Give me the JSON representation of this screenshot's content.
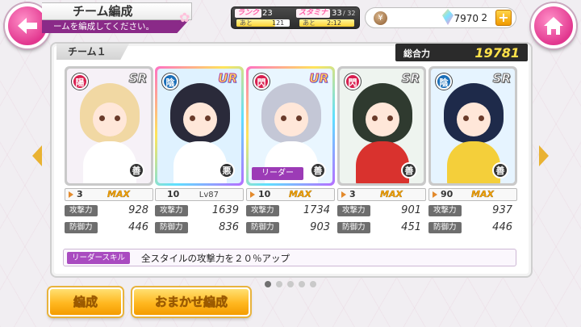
{
  "header": {
    "title": "チーム編成",
    "subtitle": "ームを編成してください。"
  },
  "status": {
    "rank_label": "ランク",
    "rank_value": "23",
    "rank_next_label": "あと",
    "rank_next_value": "121",
    "stamina_label": "スタミナ",
    "stamina_value": "33",
    "stamina_max": "/ 32",
    "stamina_next_label": "あと",
    "stamina_next_value": "2:12",
    "rank_progress": 0.72,
    "stamina_progress": 1.0
  },
  "currency": {
    "gold": "7970",
    "crystals": "2",
    "plus_label": "+"
  },
  "team": {
    "tab_label": "チーム１",
    "power_label": "総合力",
    "power_value": "19781"
  },
  "cards": [
    {
      "rarity": "SR",
      "type": "陽",
      "type_color": "#d81f4f",
      "alignment": "善",
      "level": "3",
      "level_text": "MAX",
      "attack_label": "攻撃力",
      "attack": "928",
      "defense_label": "防御力",
      "defense": "446",
      "leader": false,
      "frame": "#c9c9c9",
      "bg": "#f6f1f7",
      "hair": "#f1d8a3",
      "outfit": "#ffffff"
    },
    {
      "rarity": "UR",
      "type": "陰",
      "type_color": "#1b6fb8",
      "alignment": "悪",
      "level": "10",
      "level_text": "Lv87",
      "attack_label": "攻撃力",
      "attack": "1639",
      "defense_label": "防御力",
      "defense": "836",
      "leader": false,
      "frame": "linear-gradient(135deg,#ff6fc5,#ffe45a,#5ee0ff,#b76cff)",
      "bg": "#dff2ff",
      "hair": "#2a2a3a",
      "outfit": "#ffffff"
    },
    {
      "rarity": "UR",
      "type": "閃",
      "type_color": "#d81f4f",
      "alignment": "善",
      "level": "10",
      "level_text": "MAX",
      "attack_label": "攻撃力",
      "attack": "1734",
      "defense_label": "防御力",
      "defense": "903",
      "leader": true,
      "leader_label": "リーダー",
      "frame": "linear-gradient(135deg,#ff6fc5,#ffe45a,#5ee0ff,#b76cff)",
      "bg": "#e9f6ff",
      "hair": "#c4c7d6",
      "outfit": "#ffffff"
    },
    {
      "rarity": "SR",
      "type": "閃",
      "type_color": "#d81f4f",
      "alignment": "善",
      "level": "3",
      "level_text": "MAX",
      "attack_label": "攻撃力",
      "attack": "901",
      "defense_label": "防御力",
      "defense": "451",
      "leader": false,
      "frame": "#c9c9c9",
      "bg": "#eef4ef",
      "hair": "#2f3a2f",
      "outfit": "#d9322e"
    },
    {
      "rarity": "SR",
      "type": "陰",
      "type_color": "#1b6fb8",
      "alignment": "善",
      "level": "90",
      "level_text": "MAX",
      "attack_label": "攻撃力",
      "attack": "937",
      "defense_label": "防御力",
      "defense": "446",
      "leader": false,
      "frame": "#c9c9c9",
      "bg": "#e6f4ff",
      "hair": "#1e2a4a",
      "outfit": "#f4cf3a"
    }
  ],
  "leader_skill": {
    "label": "リーダースキル",
    "text": "全スタイルの攻撃力を２０％アップ"
  },
  "pagination": {
    "count": 5,
    "active": 0
  },
  "buttons": {
    "formation": "編成",
    "auto_formation": "おまかせ編成"
  },
  "colors": {
    "accent_pink": "#e2378f",
    "purple": "#8a2a88",
    "gold_button": "#ffb71f"
  }
}
